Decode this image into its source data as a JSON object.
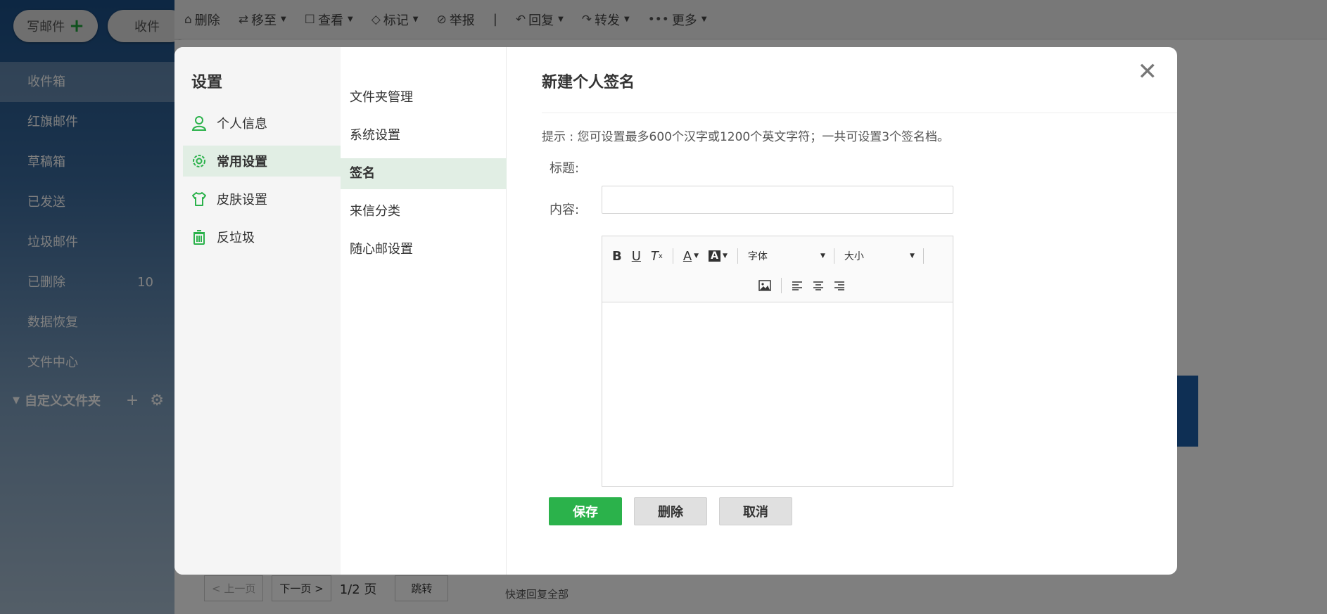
{
  "sidebar": {
    "compose_label": "写邮件",
    "receive_label": "收件",
    "items": [
      {
        "label": "收件箱",
        "count": ""
      },
      {
        "label": "红旗邮件",
        "count": ""
      },
      {
        "label": "草稿箱",
        "count": ""
      },
      {
        "label": "已发送",
        "count": ""
      },
      {
        "label": "垃圾邮件",
        "count": ""
      },
      {
        "label": "已删除",
        "count": "10"
      },
      {
        "label": "数据恢复",
        "count": ""
      },
      {
        "label": "文件中心",
        "count": ""
      }
    ],
    "custom_folders_label": "自定义文件夹"
  },
  "toolbar": {
    "delete": "删除",
    "move_to": "移至",
    "view": "查看",
    "mark": "标记",
    "report": "举报",
    "reply": "回复",
    "forward": "转发",
    "more": "更多"
  },
  "background": {
    "prev_page": "< 上一页",
    "next_page": "下一页 >",
    "page_indicator": "1/2 页",
    "jump": "跳转",
    "quick_reply_all": "快速回复全部"
  },
  "modal": {
    "settings_title": "设置",
    "nav1": [
      {
        "label": "个人信息",
        "icon": "user-icon"
      },
      {
        "label": "常用设置",
        "icon": "gear-icon"
      },
      {
        "label": "皮肤设置",
        "icon": "shirt-icon"
      },
      {
        "label": "反垃圾",
        "icon": "trash-icon"
      }
    ],
    "nav2": [
      "文件夹管理",
      "系统设置",
      "签名",
      "来信分类",
      "随心邮设置"
    ],
    "content_title": "新建个人签名",
    "tip": "提示 : 您可设置最多600个汉字或1200个英文字符；一共可设置3个签名档。",
    "title_label": "标题:",
    "title_value": "",
    "content_label": "内容:",
    "font_label": "字体",
    "size_label": "大小",
    "save_label": "保存",
    "delete_label": "删除",
    "cancel_label": "取消"
  },
  "colors": {
    "accent_green": "#2bb24b",
    "active_bg": "#e1eee4",
    "sidebar_blue": "#1a4e86"
  }
}
